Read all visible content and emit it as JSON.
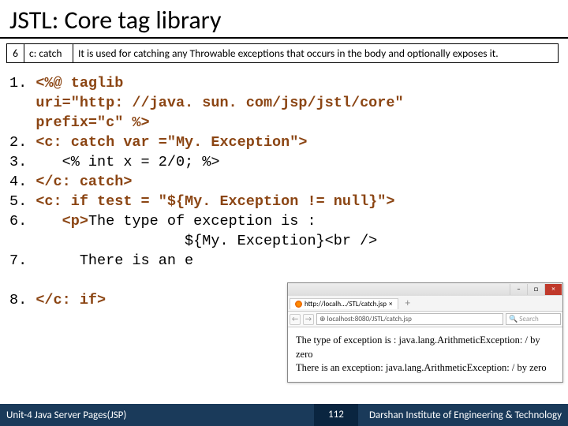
{
  "title": "JSTL: Core tag library",
  "table": {
    "num": "6",
    "tag": "c: catch",
    "desc": "It is used for catching any Throwable exceptions that occurs in the body and optionally exposes it."
  },
  "code": {
    "l1a": "1. ",
    "l1b": "<%@ taglib",
    "l2": "uri=\"http: //java. sun. com/jsp/jstl/core\"",
    "l3": "prefix=\"c\" %>",
    "l4a": "2. ",
    "l4k": "<c: catch var =\"My. Exception\">",
    "l5a": "3.    ",
    "l5b": "<% int x = 2/0; %>",
    "l6a": "4. ",
    "l6k": "</c: catch>",
    "l7a": "5. ",
    "l7k": "<c: if test = \"${My. Exception != null}\">",
    "l8a": "6.    ",
    "l8k": "<p>",
    "l8b": "The type of exception is :",
    "l9": "                    ${My. Exception}<br />",
    "l10a": "7.      ",
    "l10b": "There is an e",
    "l11a": "8. ",
    "l11k": "</c: if>"
  },
  "browser": {
    "tabTitle": "http://localh.../STL/catch.jsp",
    "url": "localhost:8080/JSTL/catch.jsp",
    "searchPlaceholder": "Search",
    "line1": "The type of exception is : java.lang.ArithmeticException: / by zero",
    "line2": "There is an exception: java.lang.ArithmeticException: / by zero"
  },
  "footer": {
    "left": "Unit-4 Java Server Pages(JSP)",
    "page": "112",
    "right": "Darshan Institute of Engineering & Technology"
  }
}
